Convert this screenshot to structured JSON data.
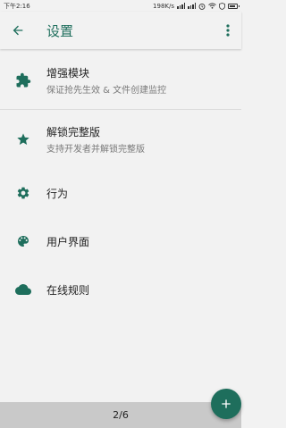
{
  "status_bar": {
    "time": "下午2:16",
    "net_speed": "198K/s"
  },
  "app_bar": {
    "title": "设置"
  },
  "items": [
    {
      "title": "增强模块",
      "subtitle": "保证抢先生效 & 文件创建监控",
      "icon": "puzzle-icon"
    },
    {
      "title": "解锁完整版",
      "subtitle": "支持开发者并解锁完整版",
      "icon": "star-icon"
    },
    {
      "title": "行为",
      "icon": "gear-icon"
    },
    {
      "title": "用户界面",
      "icon": "palette-icon"
    },
    {
      "title": "在线规则",
      "icon": "cloud-icon"
    }
  ],
  "page_indicator": "2/6",
  "colors": {
    "accent": "#1e6e5c",
    "background": "#f2f2f2",
    "bottom_bar": "#c9c9c9"
  }
}
